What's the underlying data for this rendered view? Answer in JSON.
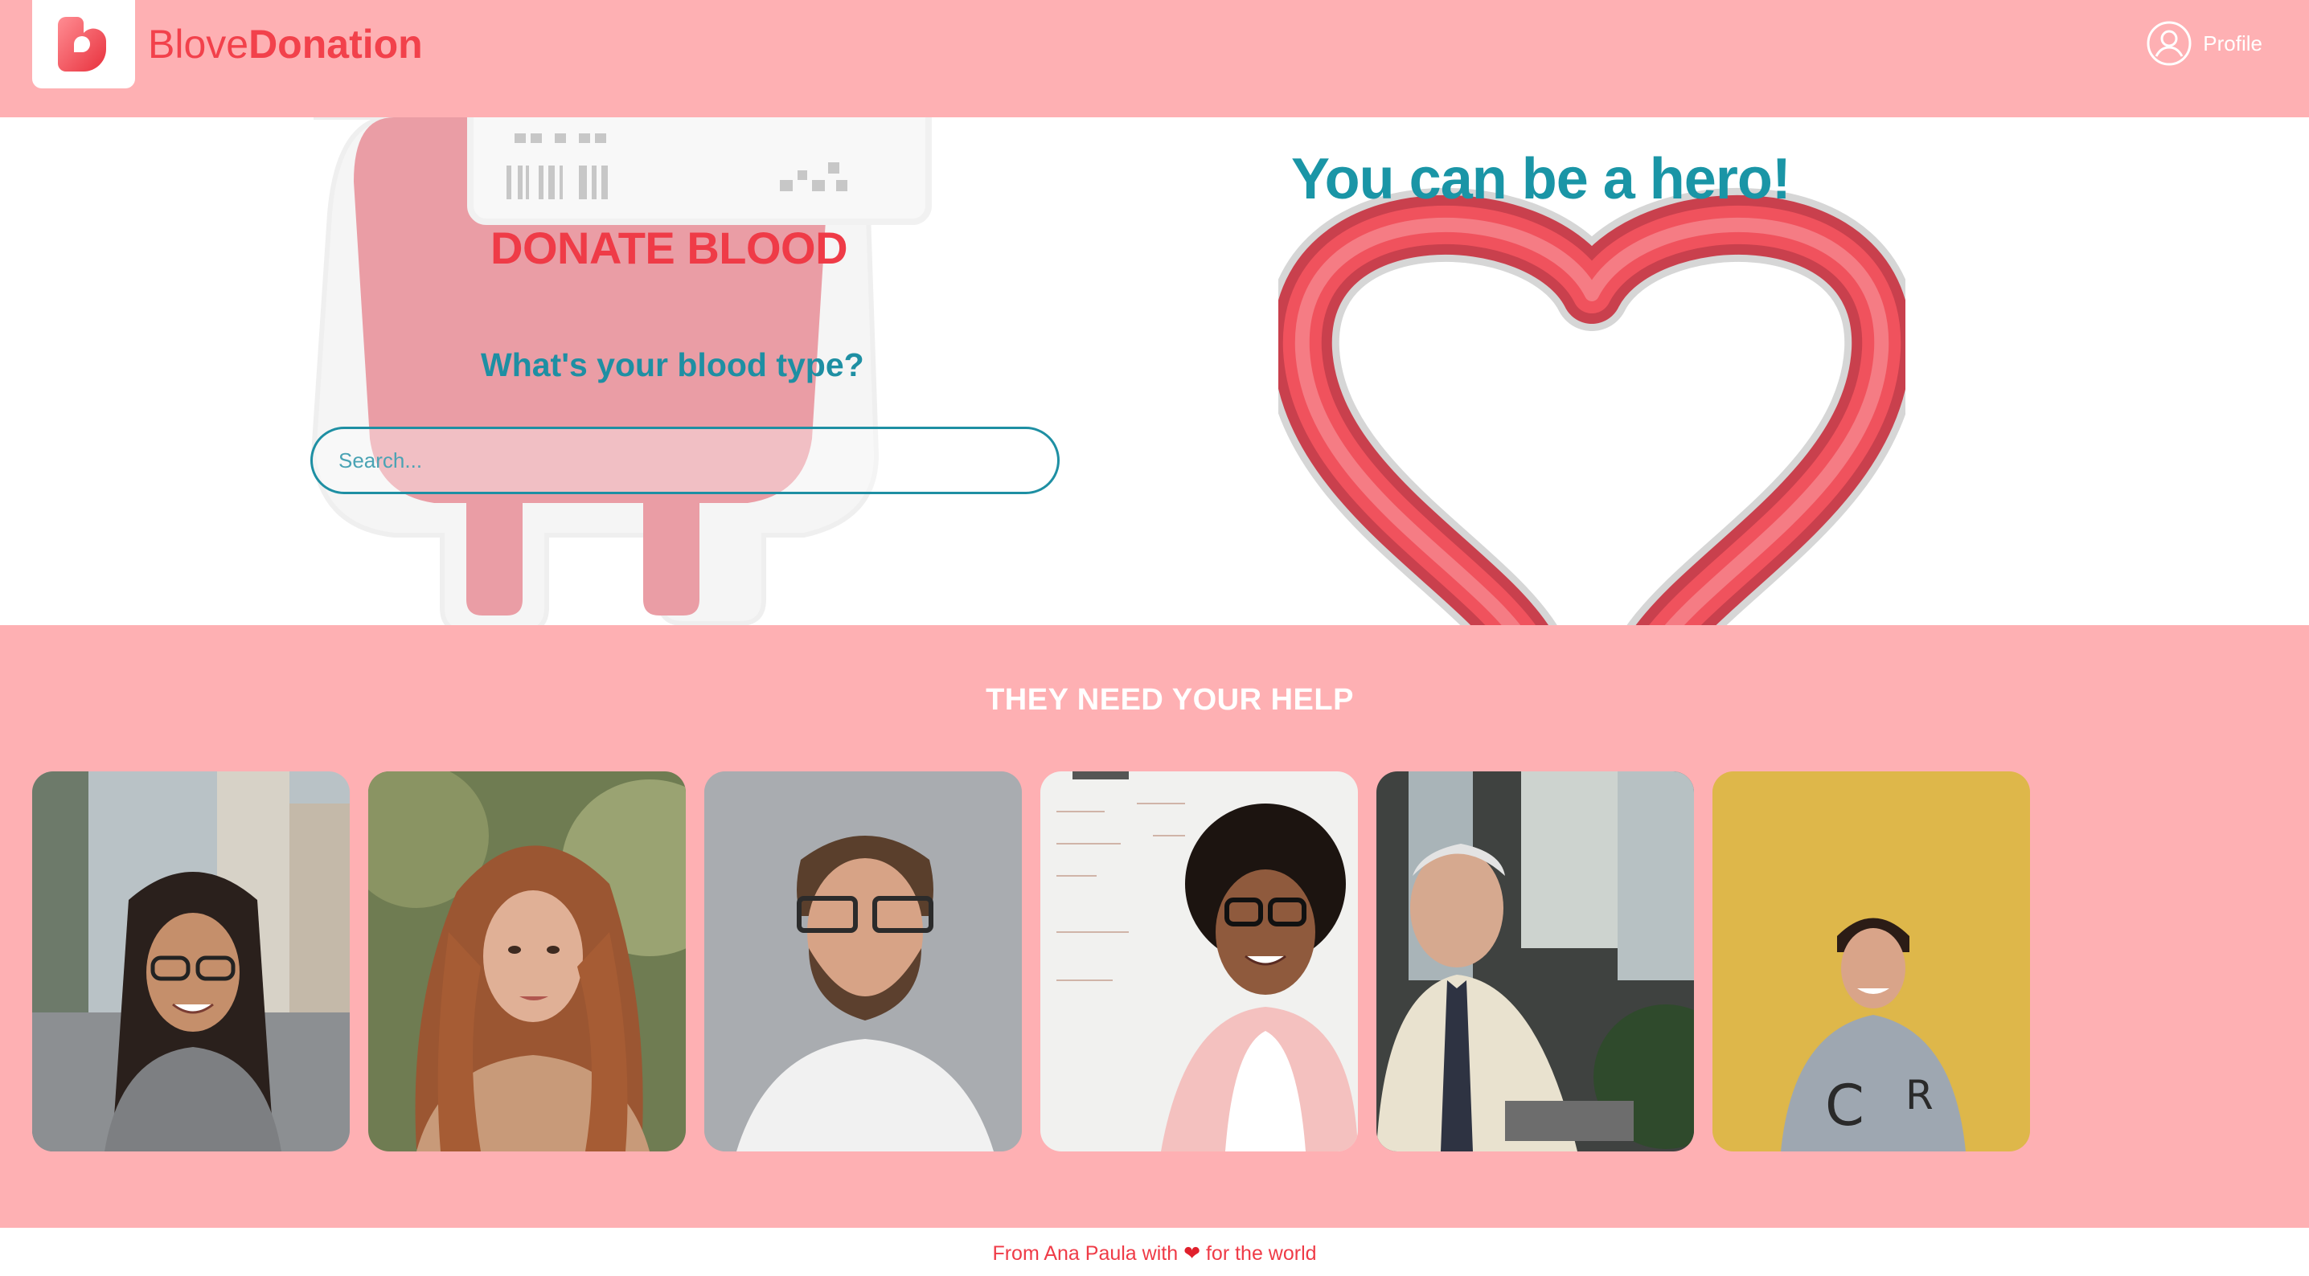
{
  "header": {
    "brand_light": "Blove",
    "brand_bold": "Donation",
    "profile_label": "Profile",
    "logo_icon": "heart-logo-icon",
    "profile_icon": "user-circle-icon"
  },
  "hero": {
    "donate_title": "DONATE BLOOD",
    "blood_type_question": "What's your blood type?",
    "search_placeholder": "Search...",
    "hero_title": "You can be a hero!"
  },
  "help": {
    "title": "THEY NEED YOUR HELP",
    "people": [
      {
        "photo": "person-1-photo"
      },
      {
        "photo": "person-2-photo"
      },
      {
        "photo": "person-3-photo"
      },
      {
        "photo": "person-4-photo"
      },
      {
        "photo": "person-5-photo"
      },
      {
        "photo": "person-6-photo"
      }
    ]
  },
  "footer": {
    "prefix": "From Ana Paula with",
    "heart": "❤",
    "suffix": "for the world"
  },
  "colors": {
    "accent_pink": "#feb0b3",
    "brand_red": "#f2414b",
    "teal": "#1e8fa3"
  }
}
